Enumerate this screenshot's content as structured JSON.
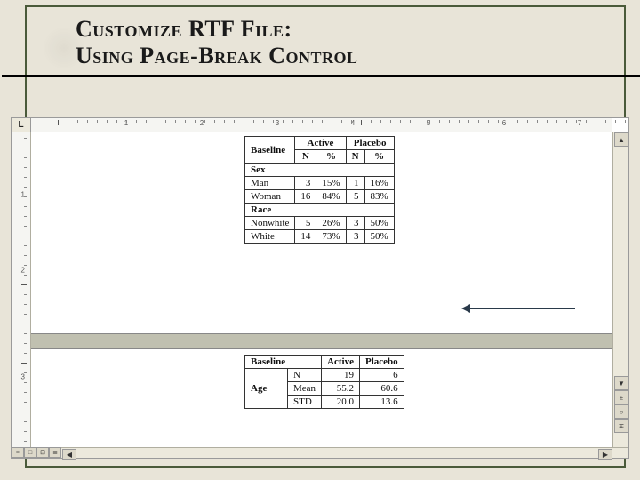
{
  "title": {
    "line1": "Customize RTF File:",
    "line2": "Using Page-Break Control"
  },
  "ruler": {
    "tab_glyph": "L",
    "h_numbers": [
      "1",
      "2",
      "3",
      "4",
      "5",
      "6",
      "7"
    ],
    "v_numbers": [
      "1",
      "2",
      "3"
    ]
  },
  "scrollbar": {
    "up": "▲",
    "down": "▼",
    "dbl_up": "±",
    "circle": "○",
    "dbl_down": "∓",
    "left": "◀",
    "right": "▶"
  },
  "view_buttons": [
    "≡",
    "□",
    "⊟",
    "≣"
  ],
  "table1": {
    "col_headers": {
      "baseline": "Baseline",
      "active": "Active",
      "placebo": "Placebo",
      "n": "N",
      "pct": "%"
    },
    "groups": [
      {
        "name": "Sex",
        "rows": [
          {
            "label": "Man",
            "active_n": "3",
            "active_pct": "15%",
            "placebo_n": "1",
            "placebo_pct": "16%"
          },
          {
            "label": "Woman",
            "active_n": "16",
            "active_pct": "84%",
            "placebo_n": "5",
            "placebo_pct": "83%"
          }
        ]
      },
      {
        "name": "Race",
        "rows": [
          {
            "label": "Nonwhite",
            "active_n": "5",
            "active_pct": "26%",
            "placebo_n": "3",
            "placebo_pct": "50%"
          },
          {
            "label": "White",
            "active_n": "14",
            "active_pct": "73%",
            "placebo_n": "3",
            "placebo_pct": "50%"
          }
        ]
      }
    ]
  },
  "table2": {
    "col_headers": {
      "baseline": "Baseline",
      "active": "Active",
      "placebo": "Placebo"
    },
    "group": "Age",
    "rows": [
      {
        "label": "N",
        "active": "19",
        "placebo": "6"
      },
      {
        "label": "Mean",
        "active": "55.2",
        "placebo": "60.6"
      },
      {
        "label": "STD",
        "active": "20.0",
        "placebo": "13.6"
      }
    ]
  }
}
